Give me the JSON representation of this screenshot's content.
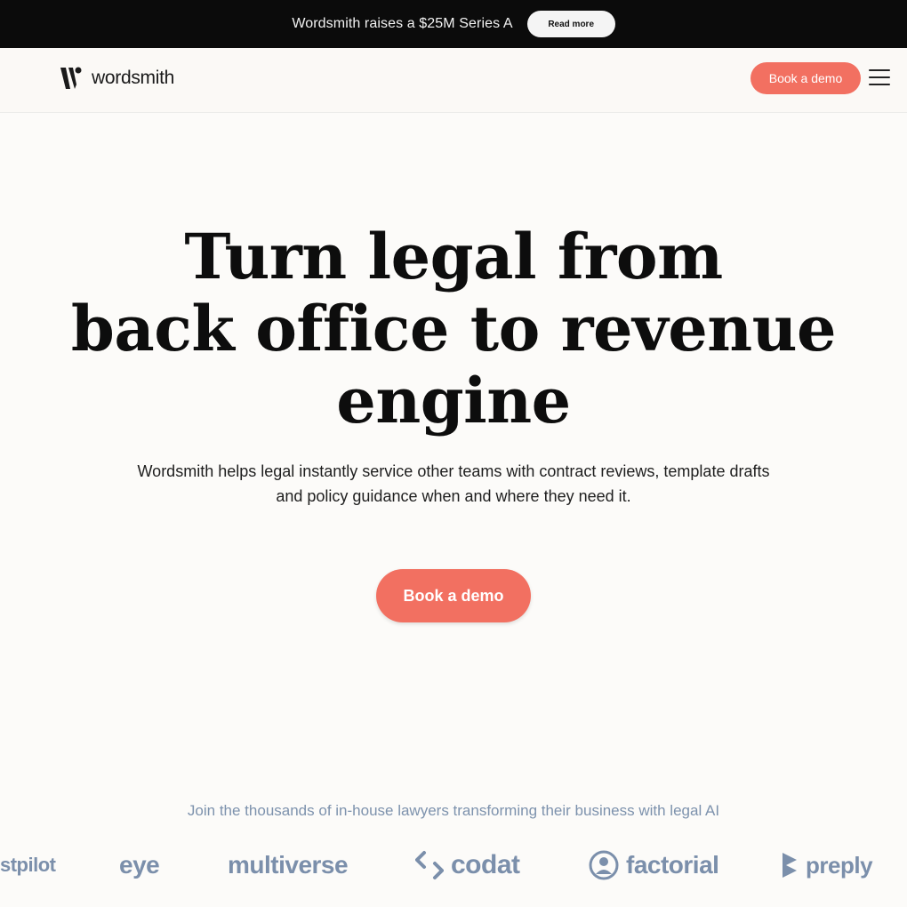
{
  "announcement": {
    "text": "Wordsmith raises a $25M Series A",
    "cta": "Read more"
  },
  "header": {
    "logo_text": "wordsmith",
    "logo_icon": "wordsmith-logo-mark",
    "cta": "Book a demo",
    "menu_icon": "hamburger-menu-icon"
  },
  "hero": {
    "title_lines": [
      "Turn legal from",
      "back office to revenue",
      "engine"
    ],
    "subtitle": "Wordsmith helps legal instantly service other teams with contract reviews, template drafts and policy guidance when and where they need it.",
    "cta": "Book a demo"
  },
  "social_proof": {
    "heading": "Join the thousands of in-house lawyers transforming their business with legal AI",
    "logos": [
      "stpilot",
      "eye",
      "multiverse",
      "codat",
      "factorial",
      "preply"
    ]
  },
  "colors": {
    "accent": "#f27061",
    "announcement_bg": "#0b0b0b",
    "page_bg": "#fcfbf9",
    "logo_gray": "#7b8fab"
  }
}
